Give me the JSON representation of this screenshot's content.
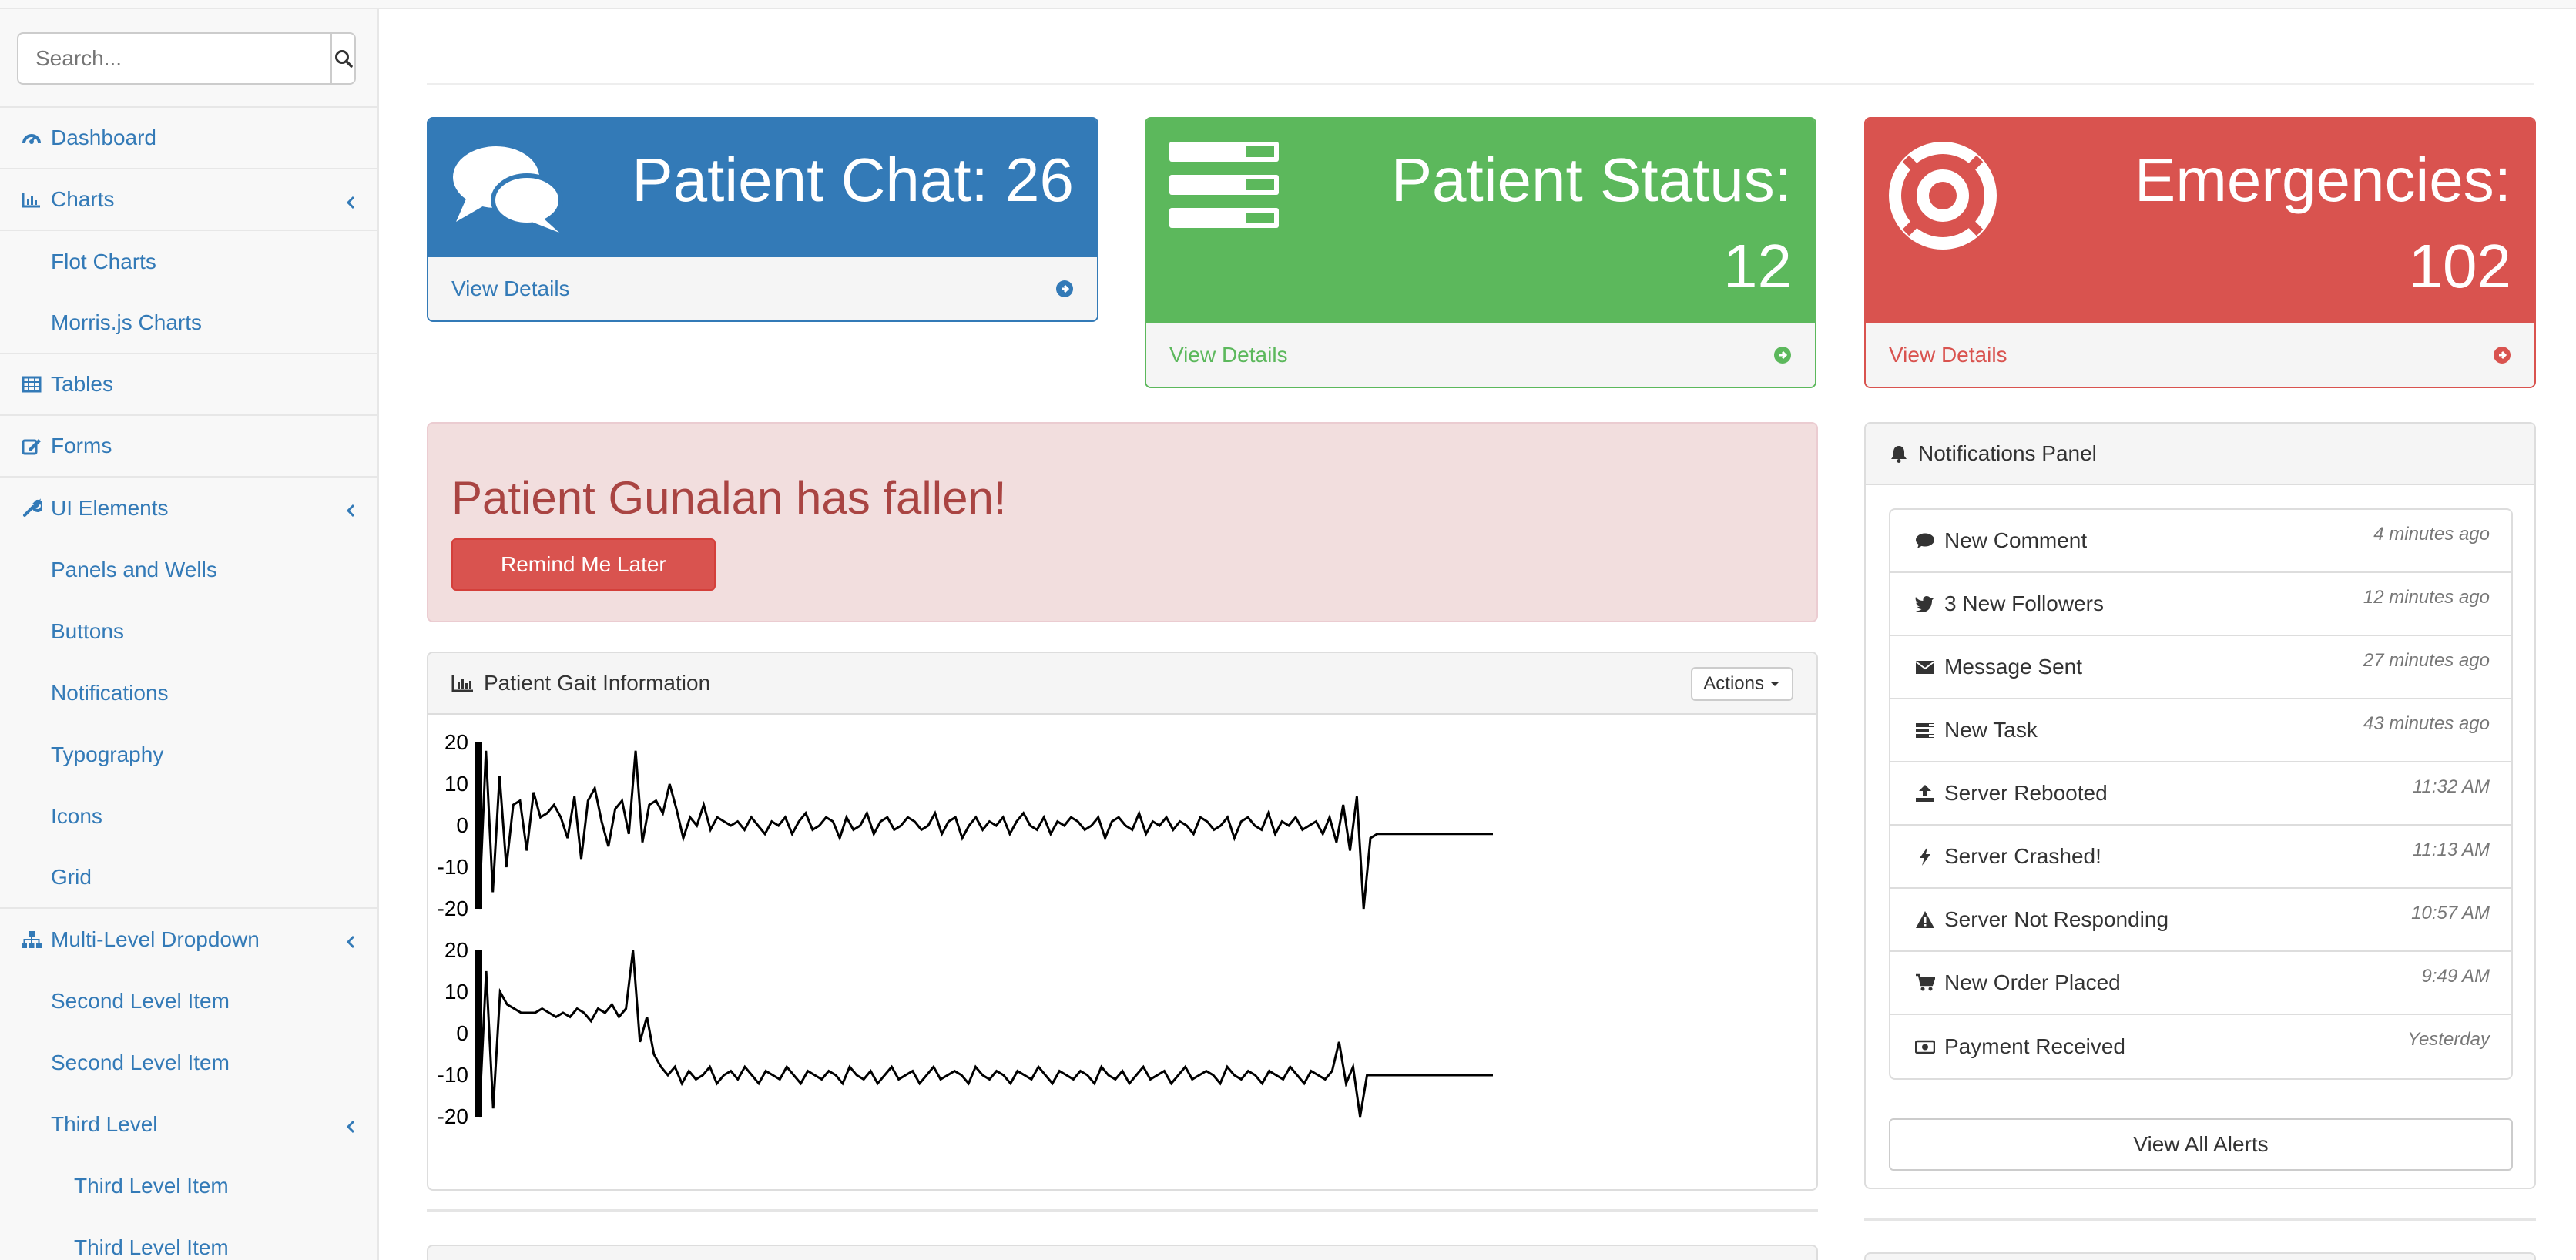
{
  "search": {
    "placeholder": "Search..."
  },
  "sidebar": {
    "items": [
      {
        "label": "Dashboard",
        "icon": "dashboard-icon",
        "type": "top"
      },
      {
        "label": "Charts",
        "icon": "bar-chart-icon",
        "type": "top",
        "expandable": true
      },
      {
        "label": "Flot Charts",
        "type": "sub"
      },
      {
        "label": "Morris.js Charts",
        "type": "sub"
      },
      {
        "label": "Tables",
        "icon": "table-icon",
        "type": "top"
      },
      {
        "label": "Forms",
        "icon": "edit-icon",
        "type": "top"
      },
      {
        "label": "UI Elements",
        "icon": "wrench-icon",
        "type": "top",
        "expandable": true
      },
      {
        "label": "Panels and Wells",
        "type": "sub"
      },
      {
        "label": "Buttons",
        "type": "sub"
      },
      {
        "label": "Notifications",
        "type": "sub"
      },
      {
        "label": "Typography",
        "type": "sub"
      },
      {
        "label": "Icons",
        "type": "sub"
      },
      {
        "label": "Grid",
        "type": "sub"
      },
      {
        "label": "Multi-Level Dropdown",
        "icon": "sitemap-icon",
        "type": "top",
        "expandable": true
      },
      {
        "label": "Second Level Item",
        "type": "sub"
      },
      {
        "label": "Second Level Item",
        "type": "sub"
      },
      {
        "label": "Third Level",
        "type": "sub",
        "expandable": true
      },
      {
        "label": "Third Level Item",
        "type": "sub3"
      },
      {
        "label": "Third Level Item",
        "type": "sub3"
      }
    ]
  },
  "stats": {
    "chat": {
      "line1": "Patient Chat: 26",
      "link": "View Details",
      "color": "#337ab7"
    },
    "status": {
      "line1": "Patient Status:",
      "line2": "12",
      "link": "View Details",
      "color": "#5cb85c"
    },
    "emergencies": {
      "line1": "Emergencies:",
      "line2": "102",
      "link": "View Details",
      "color": "#d9534f"
    }
  },
  "alert": {
    "title": "Patient Gunalan has fallen!",
    "button": "Remind Me Later"
  },
  "gait": {
    "title": "Patient Gait Information",
    "actions": "Actions"
  },
  "notifications": {
    "title": "Notifications Panel",
    "items": [
      {
        "label": "New Comment",
        "time": "4 minutes ago",
        "icon": "comment-icon"
      },
      {
        "label": "3 New Followers",
        "time": "12 minutes ago",
        "icon": "twitter-icon"
      },
      {
        "label": "Message Sent",
        "time": "27 minutes ago",
        "icon": "envelope-icon"
      },
      {
        "label": "New Task",
        "time": "43 minutes ago",
        "icon": "tasks-icon"
      },
      {
        "label": "Server Rebooted",
        "time": "11:32 AM",
        "icon": "upload-icon"
      },
      {
        "label": "Server Crashed!",
        "time": "11:13 AM",
        "icon": "bolt-icon"
      },
      {
        "label": "Server Not Responding",
        "time": "10:57 AM",
        "icon": "warning-icon"
      },
      {
        "label": "New Order Placed",
        "time": "9:49 AM",
        "icon": "shopping-cart-icon"
      },
      {
        "label": "Payment Received",
        "time": "Yesterday",
        "icon": "money-icon"
      }
    ],
    "view_all": "View All Alerts"
  },
  "chart_data": [
    {
      "type": "line",
      "title": "",
      "ylim": [
        -20,
        20
      ],
      "yticks": [
        "20",
        "10",
        "0",
        "-10",
        "-20"
      ],
      "series": [
        {
          "values": [
            -20,
            18,
            -16,
            12,
            -10,
            5,
            6,
            -6,
            8,
            2,
            3,
            5,
            2,
            -3,
            7,
            -8,
            6,
            9,
            1,
            -5,
            4,
            6,
            -2,
            18,
            -4,
            5,
            6,
            3,
            10,
            4,
            -3,
            2,
            0,
            5,
            -1,
            2,
            1,
            0,
            1,
            -1,
            2,
            0,
            -2,
            1,
            0,
            2,
            -2,
            1,
            3,
            -1,
            0,
            2,
            1,
            -3,
            2,
            -1,
            0,
            3,
            -2,
            1,
            2,
            -1,
            0,
            2,
            1,
            -1,
            0,
            3,
            -2,
            1,
            2,
            -3,
            0,
            2,
            -1,
            1,
            0,
            2,
            -2,
            1,
            3,
            0,
            -1,
            2,
            -2,
            1,
            0,
            2,
            1,
            -1,
            0,
            2,
            -3,
            1,
            2,
            0,
            -1,
            3,
            -2,
            1,
            0,
            2,
            -1,
            1,
            0,
            -2,
            2,
            1,
            -1,
            0,
            2,
            -3,
            1,
            2,
            0,
            -1,
            3,
            -2,
            1,
            0,
            2,
            -1,
            0,
            1,
            -2,
            2,
            -4,
            5,
            -6,
            7,
            -20,
            -3,
            -2,
            -2,
            -2,
            -2,
            -2,
            -2,
            -2,
            -2,
            -2,
            -2,
            -2,
            -2,
            -2,
            -2,
            -2,
            -2,
            -2,
            -2
          ]
        }
      ]
    },
    {
      "type": "line",
      "title": "",
      "ylim": [
        -20,
        20
      ],
      "yticks": [
        "20",
        "10",
        "0",
        "-10",
        "-20"
      ],
      "series": [
        {
          "values": [
            -20,
            15,
            -18,
            10,
            7,
            6,
            5,
            5,
            5,
            6,
            5,
            4,
            5,
            4,
            6,
            5,
            3,
            6,
            5,
            7,
            4,
            6,
            20,
            -2,
            4,
            -5,
            -8,
            -10,
            -8,
            -12,
            -9,
            -11,
            -10,
            -8,
            -12,
            -10,
            -9,
            -11,
            -8,
            -10,
            -12,
            -9,
            -10,
            -11,
            -8,
            -10,
            -12,
            -9,
            -10,
            -11,
            -9,
            -10,
            -12,
            -8,
            -10,
            -11,
            -9,
            -12,
            -10,
            -8,
            -11,
            -10,
            -9,
            -12,
            -10,
            -8,
            -11,
            -10,
            -9,
            -10,
            -12,
            -8,
            -10,
            -11,
            -9,
            -10,
            -12,
            -9,
            -10,
            -11,
            -8,
            -10,
            -12,
            -9,
            -10,
            -11,
            -9,
            -10,
            -12,
            -8,
            -10,
            -11,
            -9,
            -12,
            -10,
            -8,
            -11,
            -10,
            -9,
            -12,
            -10,
            -8,
            -11,
            -10,
            -9,
            -10,
            -12,
            -8,
            -10,
            -11,
            -9,
            -10,
            -12,
            -9,
            -10,
            -11,
            -8,
            -10,
            -12,
            -9,
            -10,
            -11,
            -9,
            -2,
            -12,
            -8,
            -20,
            -10,
            -10,
            -10,
            -10,
            -10,
            -10,
            -10,
            -10,
            -10,
            -10,
            -10,
            -10,
            -10,
            -10,
            -10,
            -10,
            -10,
            -10,
            -10
          ]
        }
      ]
    }
  ]
}
